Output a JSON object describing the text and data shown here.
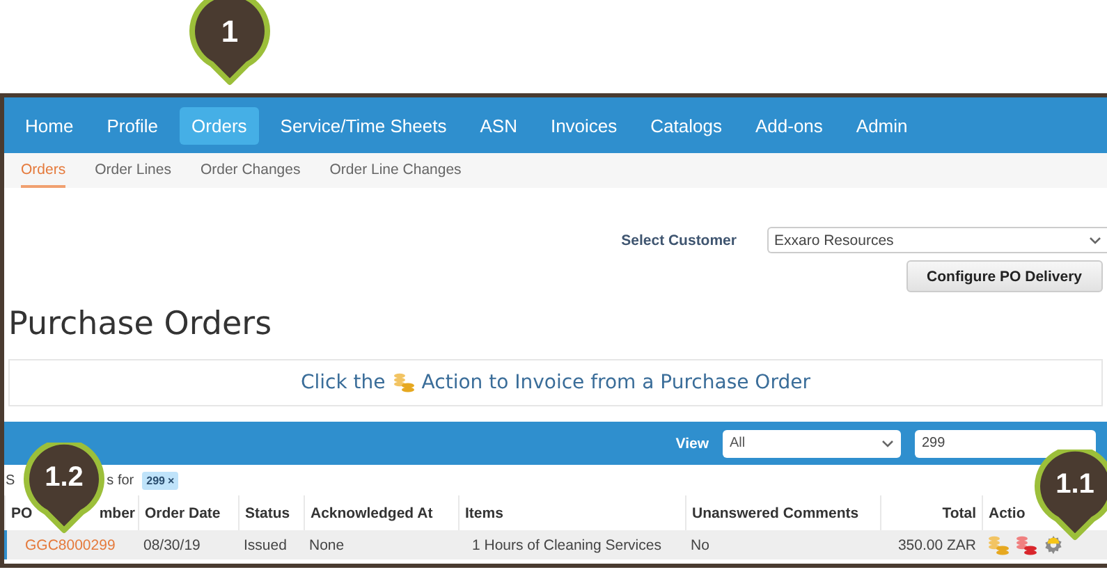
{
  "nav": {
    "items": [
      {
        "label": "Home",
        "selected": false
      },
      {
        "label": "Profile",
        "selected": false
      },
      {
        "label": "Orders",
        "selected": true
      },
      {
        "label": "Service/Time Sheets",
        "selected": false
      },
      {
        "label": "ASN",
        "selected": false
      },
      {
        "label": "Invoices",
        "selected": false
      },
      {
        "label": "Catalogs",
        "selected": false
      },
      {
        "label": "Add-ons",
        "selected": false
      },
      {
        "label": "Admin",
        "selected": false
      }
    ]
  },
  "subnav": {
    "items": [
      {
        "label": "Orders",
        "selected": true
      },
      {
        "label": "Order Lines",
        "selected": false
      },
      {
        "label": "Order Changes",
        "selected": false
      },
      {
        "label": "Order Line Changes",
        "selected": false
      }
    ]
  },
  "customer": {
    "label": "Select Customer",
    "value": "Exxaro Resources"
  },
  "configure_button": "Configure PO Delivery",
  "page_title": "Purchase Orders",
  "banner": {
    "before": "Click the",
    "after": "Action to Invoice from a Purchase Order"
  },
  "filter_bar": {
    "view_label": "View",
    "view_value": "All",
    "search_value": "299"
  },
  "results": {
    "text_start": "S",
    "text_end": "s for",
    "tag": "299",
    "tag_remove": "×"
  },
  "table": {
    "columns": [
      "PO",
      "mber",
      "Order Date",
      "Status",
      "Acknowledged At",
      "Items",
      "Unanswered Comments",
      "Total",
      "Actio"
    ],
    "rows": [
      {
        "po_number": "GGC8000299",
        "order_date": "08/30/19",
        "status": "Issued",
        "acknowledged_at": "None",
        "items": "1 Hours of Cleaning Services",
        "unanswered_comments": "No",
        "total": "350.00 ZAR",
        "actions": [
          {
            "kind": "invoice"
          },
          {
            "kind": "credit"
          },
          {
            "kind": "service"
          }
        ]
      }
    ]
  },
  "callouts": [
    {
      "label": "1"
    },
    {
      "label": "1.2"
    },
    {
      "label": "1.1"
    }
  ]
}
